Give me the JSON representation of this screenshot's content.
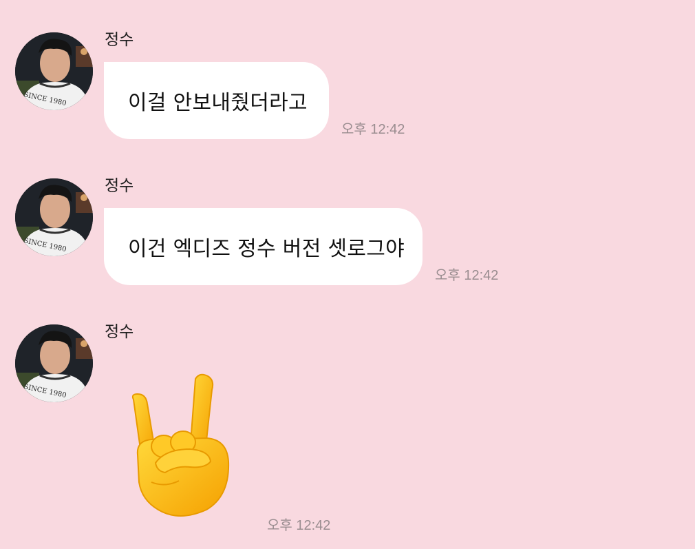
{
  "messages": [
    {
      "sender": "정수",
      "text": "이걸 안보내줬더라고",
      "time": "오후 12:42"
    },
    {
      "sender": "정수",
      "text": "이건 엑디즈 정수 버전 셋로그야",
      "time": "오후 12:42"
    },
    {
      "sender": "정수",
      "emoji": "sign-of-the-horns-icon",
      "time": "오후 12:42"
    }
  ],
  "colors": {
    "background": "#f9d9e0",
    "bubble": "#ffffff",
    "timestamp": "#9a8d90"
  },
  "avatar_shirt_text": "SINCE 1980"
}
